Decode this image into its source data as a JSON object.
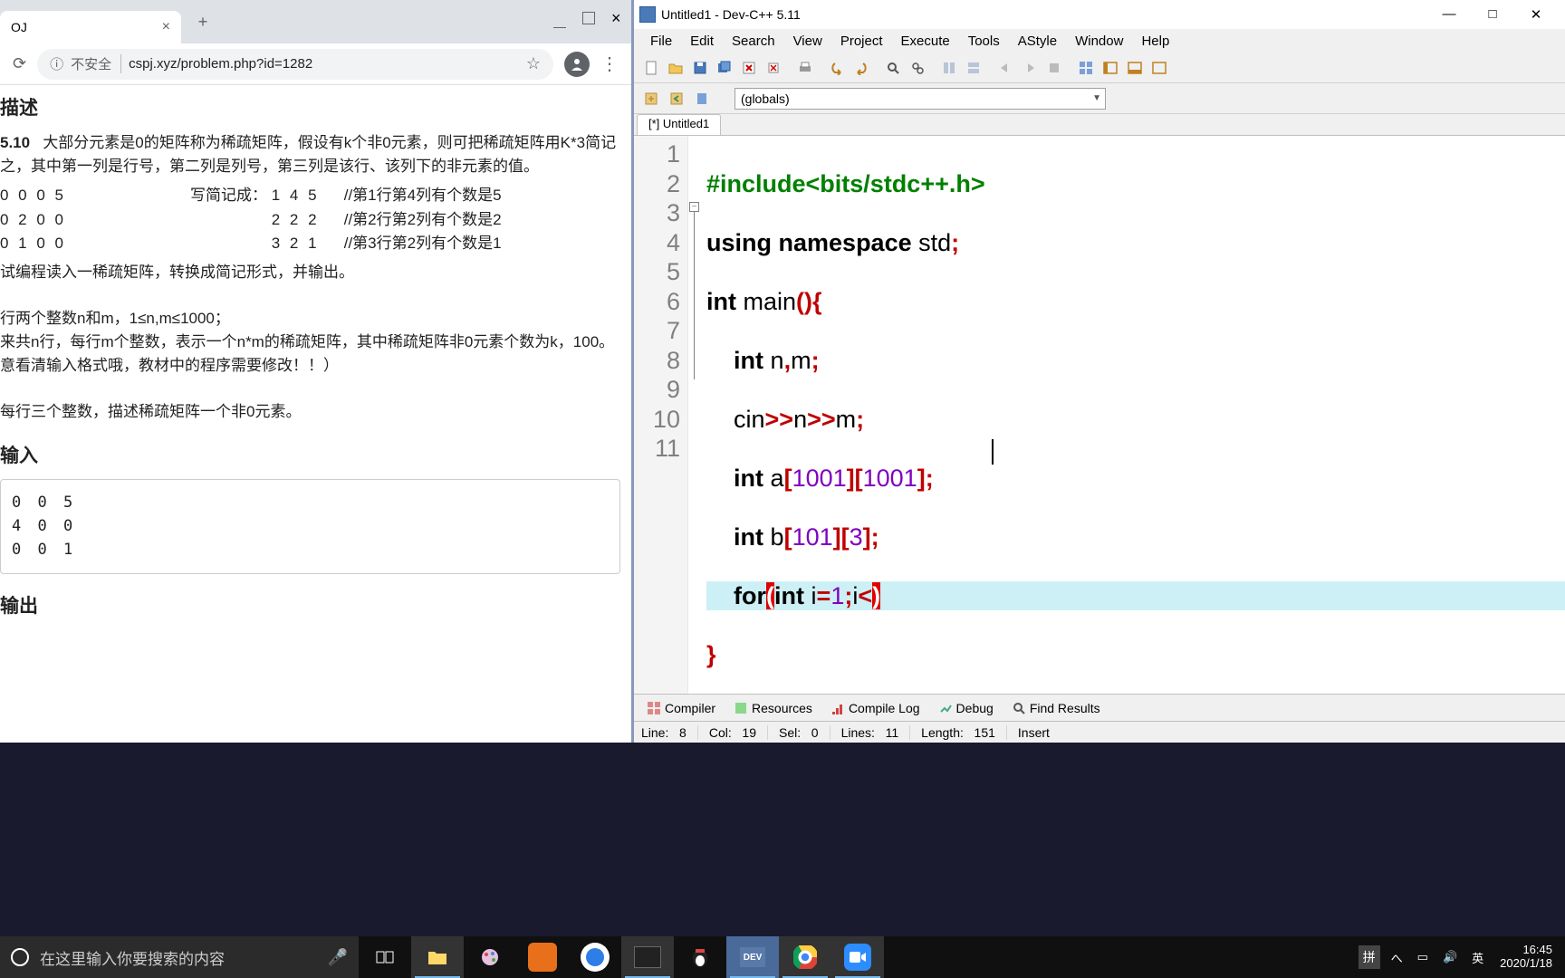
{
  "browser": {
    "tab_title": "OJ",
    "url_insecure": "不安全",
    "url": "cspj.xyz/problem.php?id=1282"
  },
  "problem": {
    "desc_heading": "描述",
    "number": "5.10",
    "intro": "大部分元素是0的矩阵称为稀疏矩阵，假设有k个非0元素，则可把稀疏矩阵用K*3简记之，其中第一列是行号，第二列是列号，第三列是该行、该列下的非元素的值。",
    "matrix": "0 0 0 5\n0 2 0 0\n0 1 0 0",
    "simple_label": "写简记成：",
    "rows": [
      {
        "m": "0 0 0 5",
        "s": "1 4 5",
        "c": "//第1行第4列有个数是5"
      },
      {
        "m": "0 2 0 0",
        "s": "2 2 2",
        "c": "//第2行第2列有个数是2"
      },
      {
        "m": "0 1 0 0",
        "s": "3 2 1",
        "c": "//第3行第2列有个数是1"
      }
    ],
    "task": "试编程读入一稀疏矩阵，转换成简记形式，并输出。",
    "input_spec1": "行两个整数n和m，1≤n,m≤1000；",
    "input_spec2": "来共n行，每行m个整数，表示一个n*m的稀疏矩阵，其中稀疏矩阵非0元素个数为k，100。",
    "input_spec3": "意看清输入格式哦，教材中的程序需要修改！！）",
    "output_spec": "每行三个整数，描述稀疏矩阵一个非0元素。",
    "sample_in_heading": "输入",
    "sample_in": "0 0 5\n4 0 0\n0 0 1",
    "sample_out_heading": "输出"
  },
  "devcpp": {
    "title": "Untitled1 - Dev-C++ 5.11",
    "menus": [
      "File",
      "Edit",
      "Search",
      "View",
      "Project",
      "Execute",
      "Tools",
      "AStyle",
      "Window",
      "Help"
    ],
    "globals": "(globals)",
    "file_tab": "[*] Untitled1",
    "code": {
      "l1_a": "#include",
      "l1_b": "<bits/stdc++.h>",
      "l2_a": "using",
      "l2_b": "namespace",
      "l2_c": "std",
      "l3_a": "int",
      "l3_b": "main",
      "l4_a": "int",
      "l4_b": "n",
      "l4_c": "m",
      "l5_a": "cin",
      "l5_b": "n",
      "l5_c": "m",
      "l6_a": "int",
      "l6_b": "a",
      "l6_n1": "1001",
      "l6_n2": "1001",
      "l7_a": "int",
      "l7_b": "b",
      "l7_n1": "101",
      "l7_n2": "3",
      "l8_a": "for",
      "l8_b": "int",
      "l8_c": "i",
      "l8_n": "1",
      "l8_d": "i"
    },
    "bottom_tabs": [
      "Compiler",
      "Resources",
      "Compile Log",
      "Debug",
      "Find Results"
    ],
    "status": {
      "line_lbl": "Line:",
      "line_val": "8",
      "col_lbl": "Col:",
      "col_val": "19",
      "sel_lbl": "Sel:",
      "sel_val": "0",
      "lines_lbl": "Lines:",
      "lines_val": "11",
      "len_lbl": "Length:",
      "len_val": "151",
      "mode": "Insert"
    }
  },
  "taskbar": {
    "search_placeholder": "在这里输入你要搜索的内容",
    "ime1": "拼",
    "ime2": "英",
    "time": "16:45",
    "date": "2020/1/18"
  }
}
